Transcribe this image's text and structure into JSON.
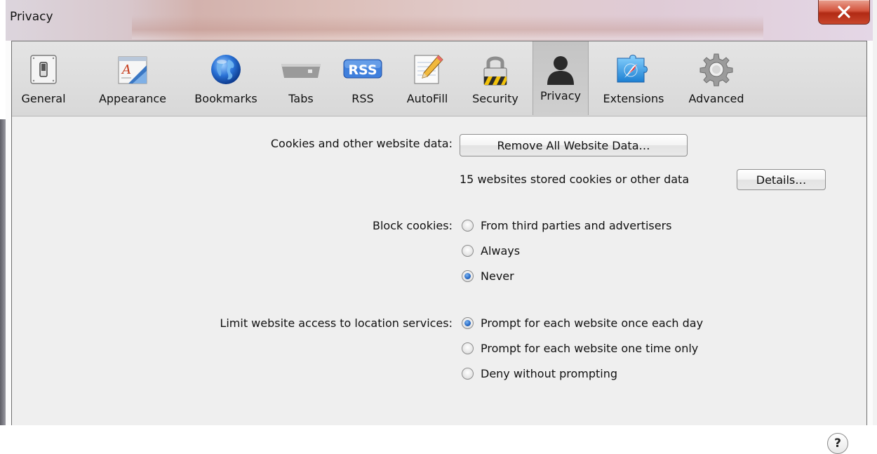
{
  "window": {
    "title": "Privacy",
    "close_icon": "close-icon"
  },
  "toolbar": {
    "active": "Privacy",
    "items": [
      {
        "label": "General",
        "icon": "general-switch-icon"
      },
      {
        "label": "Appearance",
        "icon": "appearance-icon"
      },
      {
        "label": "Bookmarks",
        "icon": "globe-icon"
      },
      {
        "label": "Tabs",
        "icon": "tabs-icon"
      },
      {
        "label": "RSS",
        "icon": "rss-icon",
        "icon_text": "RSS"
      },
      {
        "label": "AutoFill",
        "icon": "autofill-pencil-icon"
      },
      {
        "label": "Security",
        "icon": "padlock-icon"
      },
      {
        "label": "Privacy",
        "icon": "person-silhouette-icon"
      },
      {
        "label": "Extensions",
        "icon": "puzzle-compass-icon"
      },
      {
        "label": "Advanced",
        "icon": "gear-icon"
      }
    ]
  },
  "cookies": {
    "label": "Cookies and other website data:",
    "remove_button": "Remove All Website Data…",
    "status": "15 websites stored cookies or other data",
    "details_button": "Details…"
  },
  "block_cookies": {
    "label": "Block cookies:",
    "options": [
      {
        "label": "From third parties and advertisers",
        "checked": false
      },
      {
        "label": "Always",
        "checked": false
      },
      {
        "label": "Never",
        "checked": true
      }
    ]
  },
  "location": {
    "label": "Limit website access to location services:",
    "options": [
      {
        "label": "Prompt for each website once each day",
        "checked": true
      },
      {
        "label": "Prompt for each website one time only",
        "checked": false
      },
      {
        "label": "Deny without prompting",
        "checked": false
      }
    ]
  },
  "help": {
    "label": "?",
    "icon": "help-icon"
  },
  "colors": {
    "radio_selected": "#2a6dc9",
    "close_button": "#c9462c",
    "toolbar_active": "#c4c4c4"
  }
}
